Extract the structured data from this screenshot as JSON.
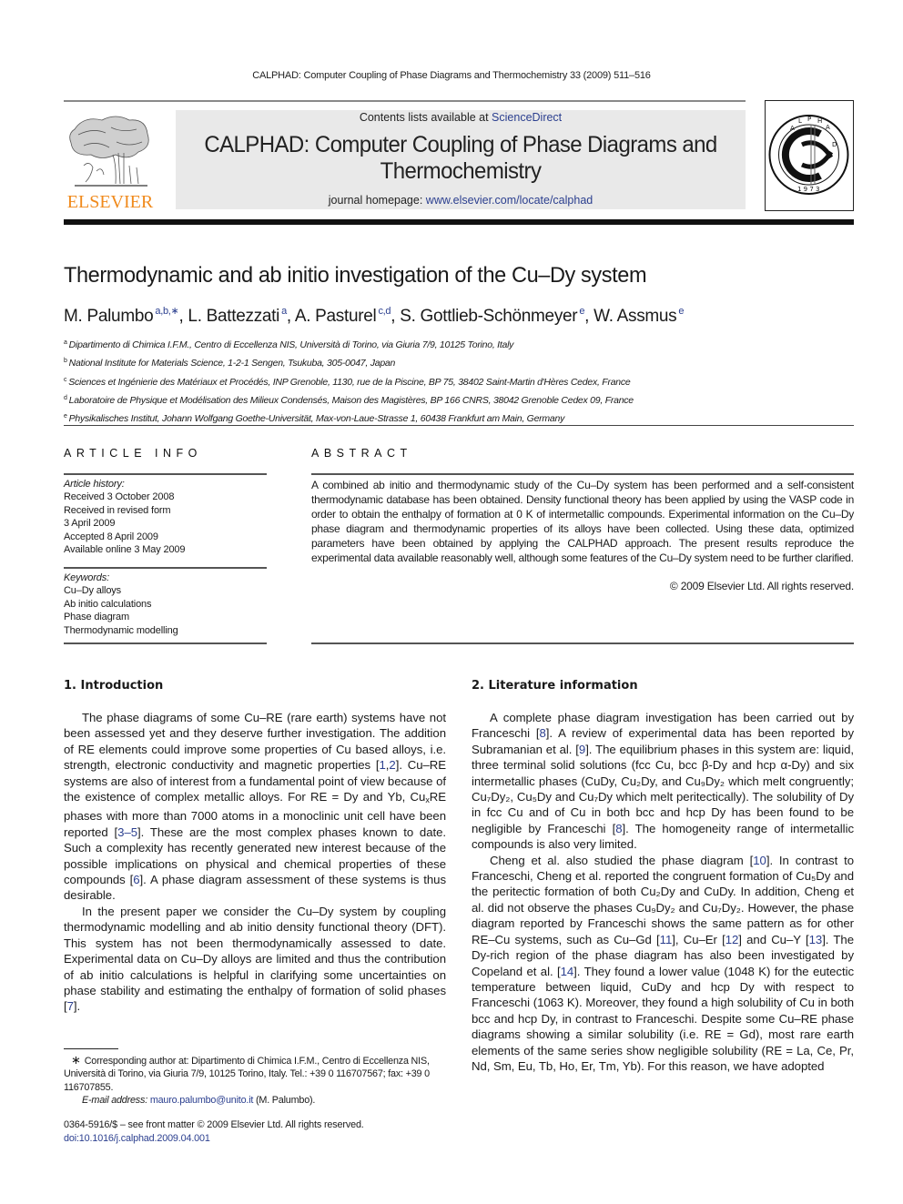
{
  "running_head": "CALPHAD: Computer Coupling of Phase Diagrams and Thermochemistry 33 (2009) 511–516",
  "masthead": {
    "publisher_name": "ELSEVIER",
    "contents_prefix": "Contents lists available at ",
    "contents_link": "ScienceDirect",
    "journal_title_line1": "CALPHAD: Computer Coupling of Phase Diagrams and",
    "journal_title_line2": "Thermochemistry",
    "homepage_prefix": "journal homepage: ",
    "homepage_link": "www.elsevier.com/locate/calphad",
    "society_logo": {
      "letters": "CALPHAD",
      "year": "1973"
    },
    "colors": {
      "elsevier_orange": "#f08a1c",
      "link_blue": "#2b3f8f",
      "banner_gray": "#e9e9e9"
    }
  },
  "article": {
    "title": "Thermodynamic and ab initio investigation of the Cu–Dy system",
    "authors": [
      {
        "name": "M. Palumbo",
        "sup": "a,b,∗"
      },
      {
        "name": "L. Battezzati",
        "sup": "a"
      },
      {
        "name": "A. Pasturel",
        "sup": "c,d"
      },
      {
        "name": "S. Gottlieb-Schönmeyer",
        "sup": "e"
      },
      {
        "name": "W. Assmus",
        "sup": "e"
      }
    ],
    "affiliations": [
      {
        "key": "a",
        "text": "Dipartimento di Chimica I.F.M., Centro di Eccellenza NIS, Università di Torino, via Giuria 7/9, 10125 Torino, Italy"
      },
      {
        "key": "b",
        "text": "National Institute for Materials Science, 1-2-1 Sengen, Tsukuba, 305-0047, Japan"
      },
      {
        "key": "c",
        "text": "Sciences et Ingénierie des Matériaux et Procédés, INP Grenoble, 1130, rue de la Piscine, BP 75, 38402 Saint-Martin d'Hères Cedex, France"
      },
      {
        "key": "d",
        "text": "Laboratoire de Physique et Modélisation des Milieux Condensés, Maison des Magistères, BP 166 CNRS, 38042 Grenoble Cedex 09, France"
      },
      {
        "key": "e",
        "text": "Physikalisches Institut, Johann Wolfgang Goethe-Universität, Max-von-Laue-Strasse 1, 60438 Frankfurt am Main, Germany"
      }
    ]
  },
  "article_info": {
    "heading": "ARTICLE INFO",
    "history_label": "Article history:",
    "history": [
      "Received 3 October 2008",
      "Received in revised form",
      "3 April 2009",
      "Accepted 8 April 2009",
      "Available online 3 May 2009"
    ],
    "keywords_label": "Keywords:",
    "keywords": [
      "Cu–Dy alloys",
      "Ab initio calculations",
      "Phase diagram",
      "Thermodynamic modelling"
    ]
  },
  "abstract": {
    "heading": "ABSTRACT",
    "text": "A combined ab initio and thermodynamic study of the Cu–Dy system has been performed and a self-consistent thermodynamic database has been obtained. Density functional theory has been applied by using the VASP code in order to obtain the enthalpy of formation at 0 K of intermetallic compounds. Experimental information on the Cu–Dy phase diagram and thermodynamic properties of its alloys have been collected. Using these data, optimized parameters have been obtained by applying the CALPHAD approach. The present results reproduce the experimental data available reasonably well, although some features of the Cu–Dy system need to be further clarified.",
    "copyright": "© 2009 Elsevier Ltd. All rights reserved."
  },
  "sections": {
    "intro": {
      "heading": "1.  Introduction",
      "p1": {
        "a": "The phase diagrams of some Cu–RE (rare earth) systems have not been assessed yet and they deserve further investigation. The addition of RE elements could improve some properties of Cu based alloys, i.e. strength, electronic conductivity and magnetic properties [",
        "ref1": "1",
        "comma": ",",
        "ref2": "2",
        "b": "]. Cu–RE systems are also of interest from a fundamental point of view because of the existence of complex metallic alloys. For RE = Dy and Yb, Cu",
        "sub_x": "x",
        "c": "RE phases with more than 7000 atoms in a monoclinic unit cell have been reported [",
        "ref3": "3–5",
        "d": "]. These are the most complex phases known to date. Such a complexity has recently generated new interest because of the possible implications on physical and chemical properties of these compounds [",
        "ref4": "6",
        "e": "]. A phase diagram assessment of these systems is thus desirable."
      },
      "p2": {
        "a": "In the present paper we consider the Cu–Dy system by coupling thermodynamic modelling and ab initio density functional theory (DFT). This system has not been thermodynamically assessed to date. Experimental data on Cu–Dy alloys are limited and thus the contribution of ab initio calculations is helpful in clarifying some uncertainties on phase stability and estimating the enthalpy of formation of solid phases [",
        "ref": "7",
        "b": "]."
      }
    },
    "literature": {
      "heading": "2.  Literature information",
      "p1": {
        "a": "A complete phase diagram investigation has been carried out by Franceschi [",
        "ref1": "8",
        "b": "]. A review of experimental data has been reported by Subramanian et al. [",
        "ref2": "9",
        "c": "]. The equilibrium phases in this system are: liquid, three terminal solid solutions (fcc Cu, bcc β-Dy and hcp α-Dy) and six intermetallic phases (CuDy, Cu₂Dy, and Cu₉Dy₂ which melt congruently; Cu₇Dy₂, Cu₅Dy and Cu₇Dy which melt peritectically). The solubility of Dy in fcc Cu and of Cu in both bcc and hcp Dy has been found to be negligible by Franceschi [",
        "ref3": "8",
        "d": "]. The homogeneity range of intermetallic compounds is also very limited."
      },
      "p2": {
        "a": "Cheng et al. also studied the phase diagram [",
        "ref1": "10",
        "b": "]. In contrast to Franceschi, Cheng et al. reported the congruent formation of Cu₅Dy and the peritectic formation of both Cu₂Dy and CuDy. In addition, Cheng et al. did not observe the phases Cu₉Dy₂ and Cu₇Dy₂. However, the phase diagram reported by Franceschi shows the same pattern as for other RE–Cu systems, such as Cu–Gd [",
        "ref2": "11",
        "c": "], Cu–Er [",
        "ref3": "12",
        "d": "] and Cu–Y [",
        "ref4": "13",
        "e": "]. The Dy-rich region of the phase diagram has also been investigated by Copeland et al. [",
        "ref5": "14",
        "f": "]. They found a lower value (1048 K) for the eutectic temperature between liquid, CuDy and hcp Dy with respect to Franceschi (1063 K). Moreover, they found a high solubility of Cu in both bcc and hcp Dy, in contrast to Franceschi. Despite some Cu–RE phase diagrams showing a similar solubility (i.e. RE = Gd), most rare earth elements of the same series show negligible solubility (RE = La, Ce, Pr, Nd, Sm, Eu, Tb, Ho, Er, Tm, Yb). For this reason, we have adopted"
      }
    }
  },
  "footnote": {
    "star": "∗",
    "text": "Corresponding author at: Dipartimento di Chimica I.F.M., Centro di Eccellenza NIS, Università di Torino, via Giuria 7/9, 10125 Torino, Italy. Tel.: +39 0 116707567; fax: +39 0 116707855.",
    "email_label": "E-mail address: ",
    "email": "mauro.palumbo@unito.it",
    "email_suffix": " (M. Palumbo)."
  },
  "front_matter": {
    "issn_line": "0364-5916/$ – see front matter © 2009 Elsevier Ltd. All rights reserved.",
    "doi": "doi:10.1016/j.calphad.2009.04.001"
  }
}
